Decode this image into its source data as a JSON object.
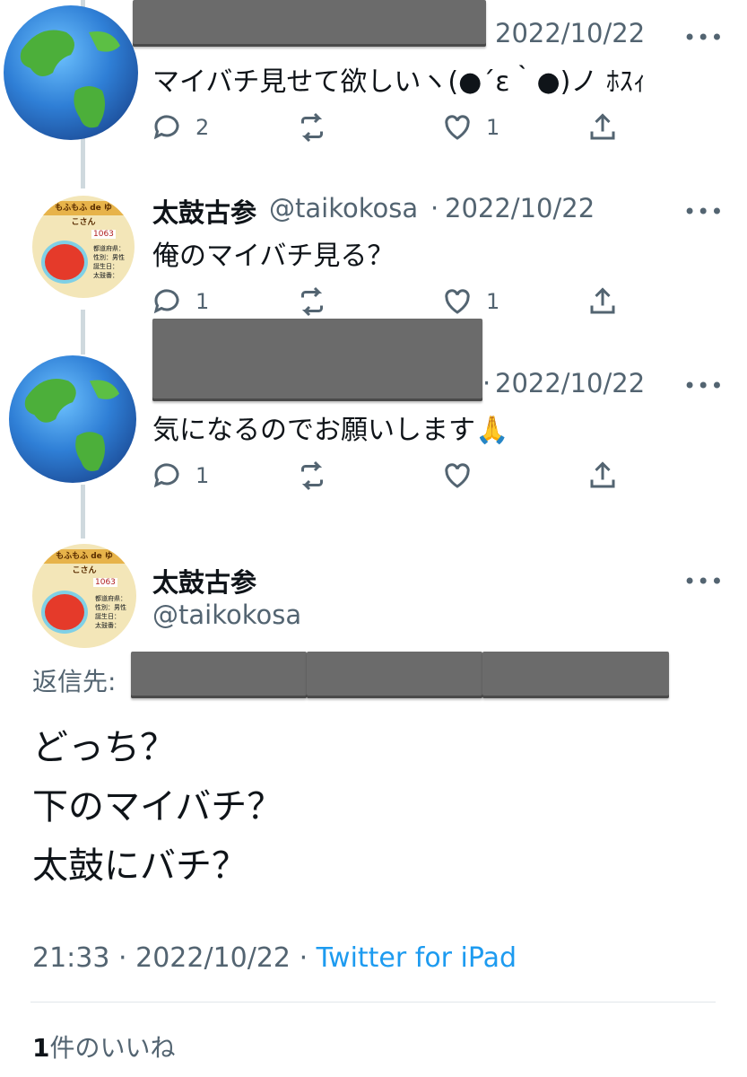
{
  "thread": {
    "tweets": [
      {
        "timestamp": "2022/10/22",
        "text": "マイバチ見せて欲しいヽ(●´ε｀●)ノ ﾎｽｨ",
        "replies": "2",
        "retweets": "",
        "likes": "1"
      },
      {
        "name": "太鼓古参",
        "handle": "@taikokosa",
        "separator": "·",
        "timestamp": "2022/10/22",
        "text": "俺のマイバチ見る？",
        "replies": "1",
        "retweets": "",
        "likes": "1"
      },
      {
        "separator": "·",
        "timestamp": "2022/10/22",
        "text": "気になるのでお願いします🙏",
        "replies": "1",
        "retweets": "",
        "likes": ""
      }
    ],
    "more_glyph": "•••"
  },
  "main_tweet": {
    "name": "太鼓古参",
    "handle": "@taikokosa",
    "reply_to_label": "返信先:",
    "lines": [
      "どっち？",
      "下のマイバチ？",
      "太鼓にバチ？"
    ],
    "time": "21:33",
    "sep": "·",
    "date": "2022/10/22",
    "sep2": "·",
    "source": "Twitter for iPad",
    "likes_count": "1",
    "likes_label": "件のいいね"
  },
  "avatar_taiko": {
    "banner": "もふもふ de ゆ",
    "sub": "こさん",
    "id": "1063",
    "rows": [
      "都道府県：",
      "性別：男性",
      "誕生日：",
      "太鼓番："
    ]
  },
  "colors": {
    "link": "#1d9bf0",
    "secondary": "#536471",
    "thread_line": "#cfd9de"
  }
}
